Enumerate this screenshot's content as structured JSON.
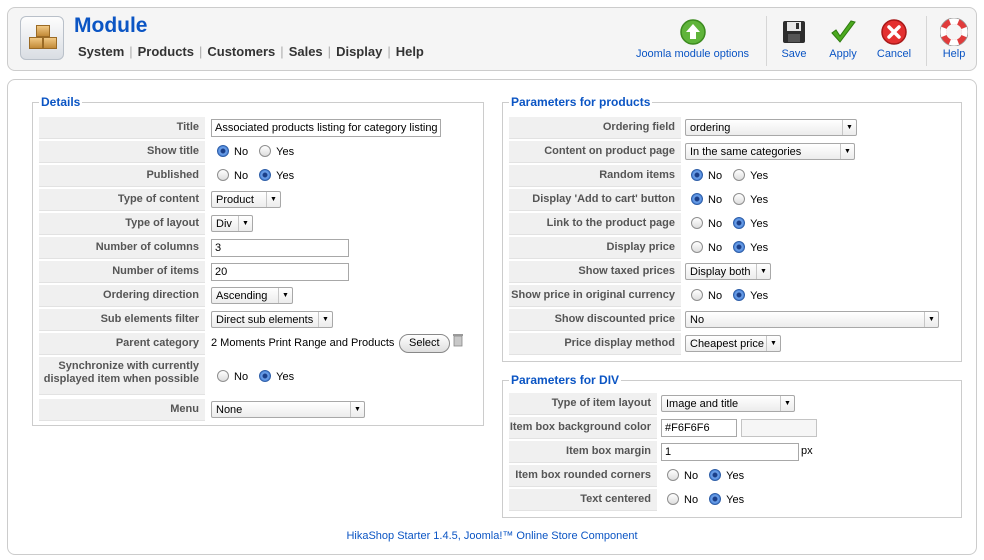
{
  "header": {
    "title": "Module",
    "menu": [
      "System",
      "Products",
      "Customers",
      "Sales",
      "Display",
      "Help"
    ],
    "toolbar": {
      "joomla_options": "Joomla module options",
      "save": "Save",
      "apply": "Apply",
      "cancel": "Cancel",
      "help": "Help"
    }
  },
  "details": {
    "legend": "Details",
    "title_label": "Title",
    "title_value": "Associated products listing for category listing",
    "show_title_label": "Show title",
    "published_label": "Published",
    "type_content_label": "Type of content",
    "type_content_value": "Product",
    "type_layout_label": "Type of layout",
    "type_layout_value": "Div",
    "num_columns_label": "Number of columns",
    "num_columns_value": "3",
    "num_items_label": "Number of items",
    "num_items_value": "20",
    "ordering_dir_label": "Ordering direction",
    "ordering_dir_value": "Ascending",
    "sub_filter_label": "Sub elements filter",
    "sub_filter_value": "Direct sub elements",
    "parent_cat_label": "Parent category",
    "parent_cat_value": "2 Moments Print Range and Products",
    "select_button": "Select",
    "sync_label": "Synchronize with currently displayed item when possible",
    "menu_label": "Menu",
    "menu_value": "None"
  },
  "products": {
    "legend": "Parameters for products",
    "ordering_field_label": "Ordering field",
    "ordering_field_value": "ordering",
    "content_label": "Content on product page",
    "content_value": "In the same categories",
    "random_label": "Random items",
    "cart_label": "Display 'Add to cart' button",
    "link_label": "Link to the product page",
    "price_label": "Display price",
    "taxed_label": "Show taxed prices",
    "taxed_value": "Display both",
    "orig_currency_label": "Show price in original currency",
    "discounted_label": "Show discounted price",
    "discounted_value": "No",
    "price_method_label": "Price display method",
    "price_method_value": "Cheapest price"
  },
  "div": {
    "legend": "Parameters for DIV",
    "item_layout_label": "Type of item layout",
    "item_layout_value": "Image and title",
    "bg_color_label": "Item box background color",
    "bg_color_value": "#F6F6F6",
    "margin_label": "Item box margin",
    "margin_value": "1",
    "margin_unit": "px",
    "rounded_label": "Item box rounded corners",
    "centered_label": "Text centered"
  },
  "radio_labels": {
    "no": "No",
    "yes": "Yes"
  },
  "footer": "HikaShop Starter 1.4.5, Joomla!™ Online Store Component"
}
